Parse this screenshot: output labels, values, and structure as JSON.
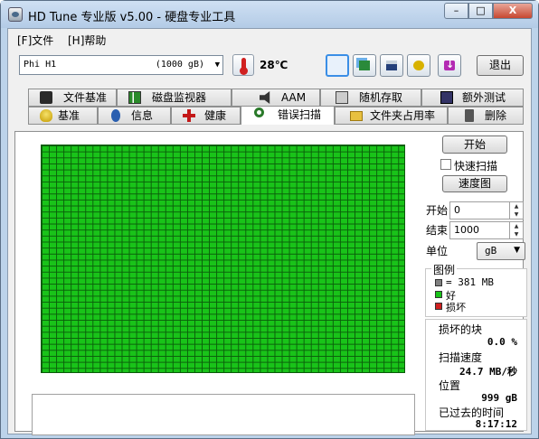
{
  "window": {
    "title": "HD Tune 专业版 v5.00 - 硬盘专业工具",
    "min": "–",
    "max": "□",
    "close": "X"
  },
  "menu": {
    "file": "[F]文件",
    "help": "[H]帮助"
  },
  "toolbar": {
    "drive_name": "Phi     H1",
    "drive_size": "(1000 gB)",
    "temperature": "28℃",
    "exit": "退出"
  },
  "tabs_row1": [
    {
      "label": "文件基准",
      "icon": "file-benchmark-icon"
    },
    {
      "label": "磁盘监视器",
      "icon": "disk-monitor-icon"
    },
    {
      "label": "AAM",
      "icon": "speaker-icon"
    },
    {
      "label": "随机存取",
      "icon": "random-access-icon"
    },
    {
      "label": "额外测试",
      "icon": "extra-tests-icon"
    }
  ],
  "tabs_row2": [
    {
      "label": "基准",
      "icon": "bulb-icon"
    },
    {
      "label": "信息",
      "icon": "info-icon"
    },
    {
      "label": "健康",
      "icon": "health-cross-icon"
    },
    {
      "label": "错误扫描",
      "icon": "magnifier-icon"
    },
    {
      "label": "文件夹占用率",
      "icon": "folder-icon"
    },
    {
      "label": "删除",
      "icon": "trash-icon"
    }
  ],
  "scan": {
    "start_button": "开始",
    "quick_scan_label": "快速扫描",
    "quick_scan_checked": false,
    "speed_map_button": "速度图",
    "start_label": "开始",
    "start_value": "0",
    "end_label": "结束",
    "end_value": "1000",
    "unit_label": "单位",
    "unit_value": "gB",
    "legend_title": "图例",
    "legend_block": "= 381 MB",
    "legend_good": "好",
    "legend_bad": "损坏",
    "bad_blocks_label": "损坏的块",
    "bad_blocks_value": "0.0 %",
    "scan_speed_label": "扫描速度",
    "scan_speed_value": "24.7 MB/秒",
    "position_label": "位置",
    "position_value": "999 gB",
    "elapsed_label": "已过去的时间",
    "elapsed_value": "8:17:12"
  },
  "colors": {
    "good": "#19c319",
    "bad": "#d02020",
    "block": "#808080"
  }
}
